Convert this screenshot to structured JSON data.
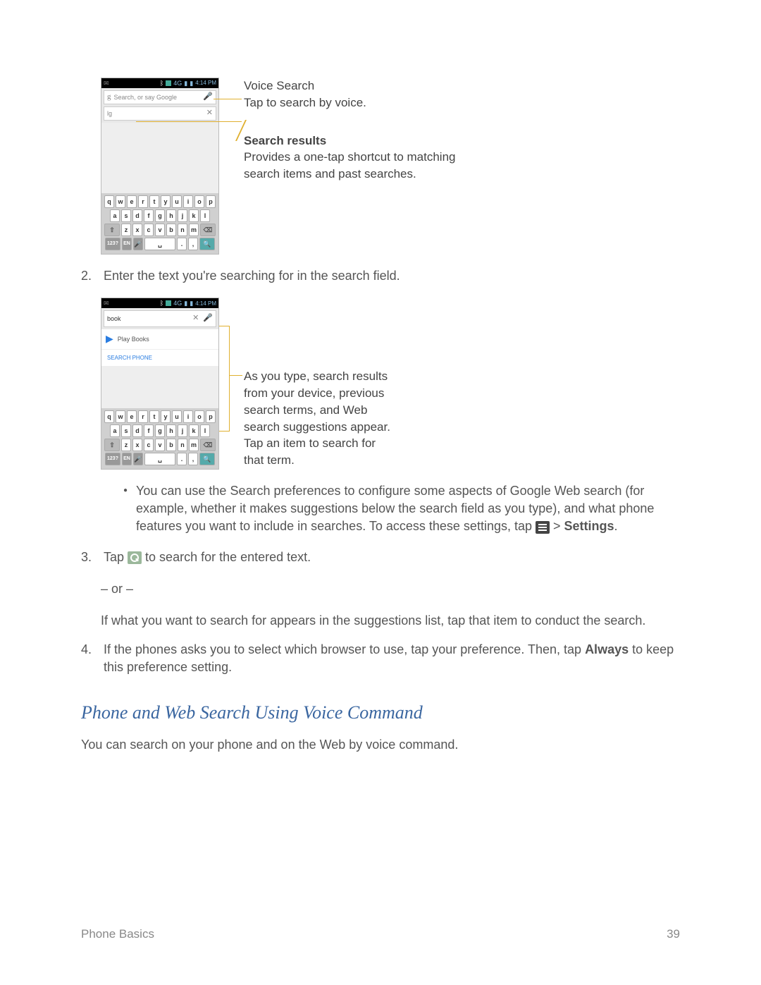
{
  "statusbar": {
    "time": "4:14 PM"
  },
  "fig1": {
    "search_placeholder": "Search, or say Google",
    "text_value": "lg",
    "annot_voice_title": "Voice Search",
    "annot_voice_sub": "Tap to search by voice.",
    "annot_results_title": "Search results",
    "annot_results_body": "Provides a one-tap shortcut to matching search items and past searches."
  },
  "step2": {
    "num": "2.",
    "text": "Enter the text you're searching for in the search field."
  },
  "fig2": {
    "text_value": "book",
    "suggestion": "Play Books",
    "search_phone": "SEARCH PHONE",
    "annot": "As you type, search results from your device, previous search terms, and Web search suggestions appear.\nTap an item to search for that term."
  },
  "bullet": {
    "text_part1": "You can use the Search preferences to configure some aspects of Google Web search (for example, whether it makes suggestions below the search field as you type), and what phone features you want to include in searches. To access these settings, tap ",
    "gt": " > ",
    "settings": "Settings",
    "period": "."
  },
  "step3": {
    "num": "3.",
    "pre": "Tap ",
    "post": " to search for the entered text.",
    "or": "– or –",
    "alt": "If what you want to search for appears in the suggestions list, tap that item to conduct the search."
  },
  "step4": {
    "num": "4.",
    "text_a": "If the phones asks you to select which browser to use, tap your preference. Then, tap ",
    "always": "Always",
    "text_b": " to keep this preference setting."
  },
  "section_heading": "Phone and Web Search Using Voice Command",
  "section_body": "You can search on your phone and on the Web by voice command.",
  "footer_left": "Phone Basics",
  "footer_right": "39",
  "kbd_rows": {
    "r1": [
      "q",
      "w",
      "e",
      "r",
      "t",
      "y",
      "u",
      "i",
      "o",
      "p"
    ],
    "r2": [
      "a",
      "s",
      "d",
      "f",
      "g",
      "h",
      "j",
      "k",
      "l"
    ],
    "r3": [
      "z",
      "x",
      "c",
      "v",
      "b",
      "n",
      "m"
    ],
    "r4_left": "123?",
    "r4_en": "EN"
  }
}
